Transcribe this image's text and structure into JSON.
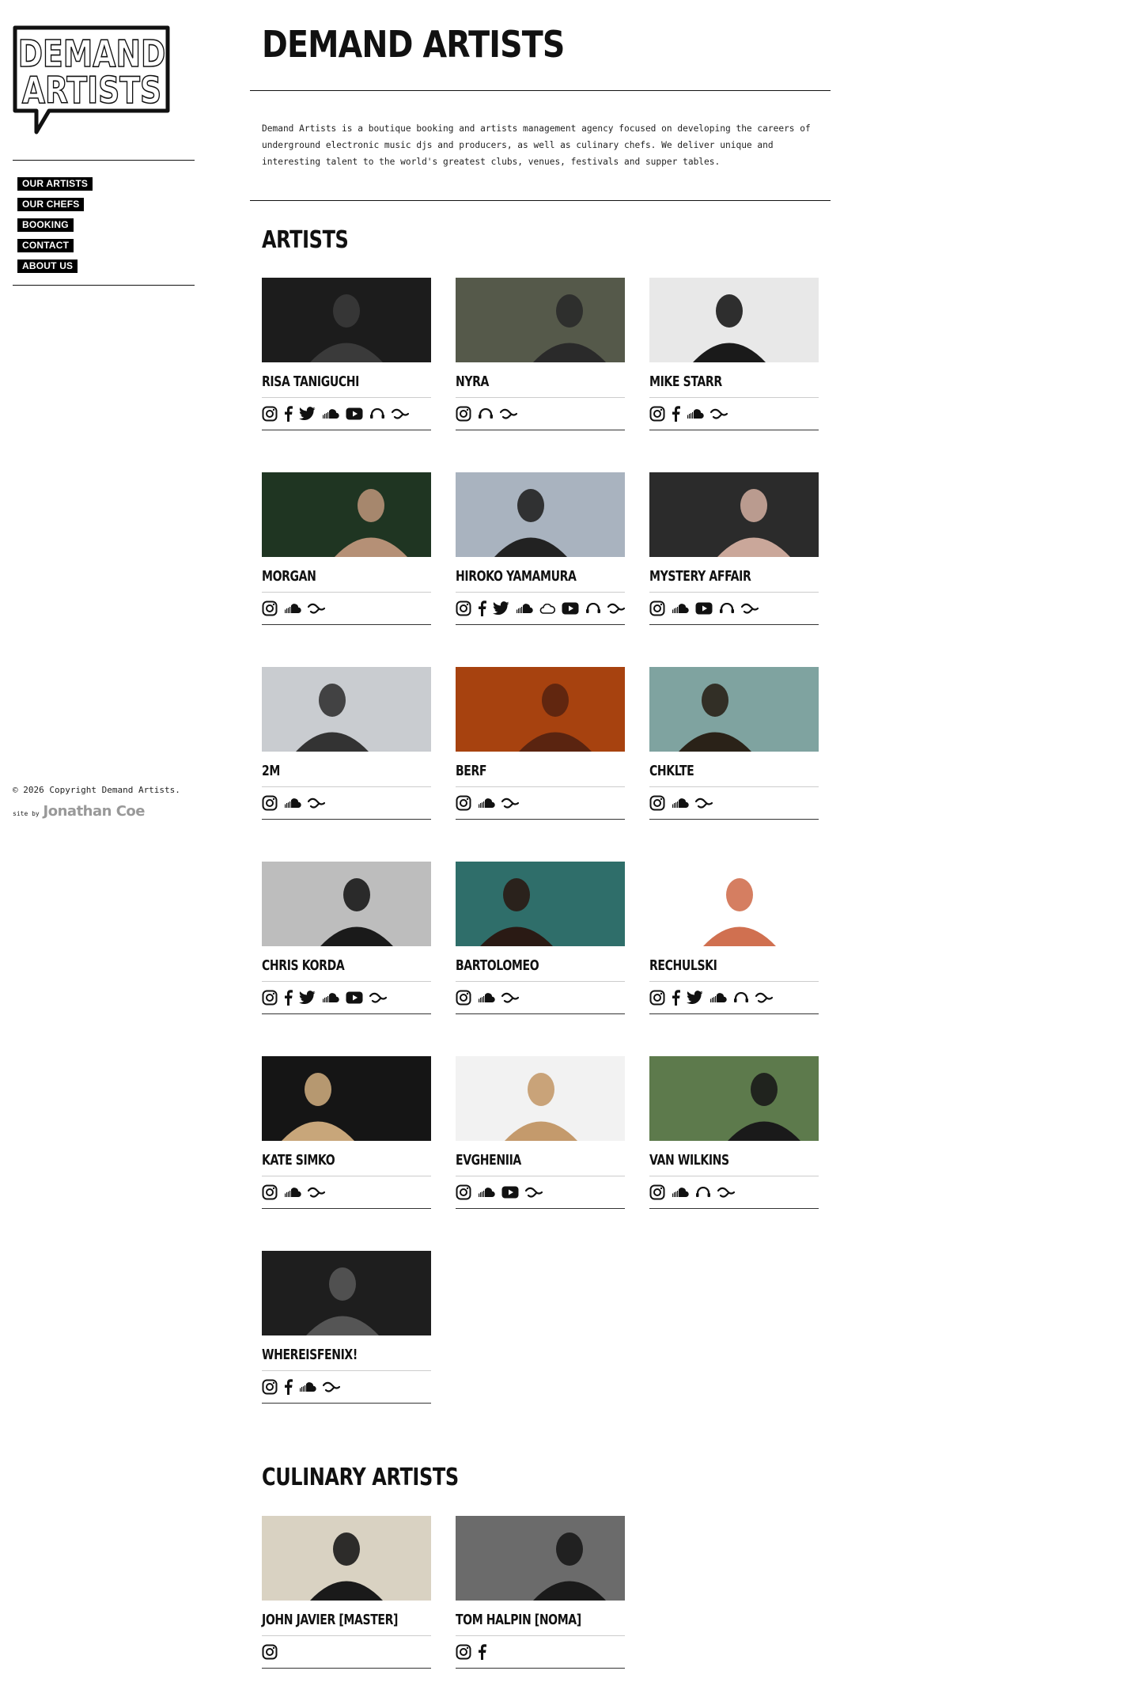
{
  "site": {
    "logo_line1": "DEMAND",
    "logo_line2": "ARTISTS",
    "title": "DEMAND ARTISTS",
    "intro": "Demand Artists is a boutique booking and artists management agency focused on developing the careers of underground electronic music djs and producers, as well as culinary chefs.  We deliver unique and interesting talent to the world's greatest clubs, venues, festivals and supper tables."
  },
  "nav": [
    {
      "label": "OUR ARTISTS"
    },
    {
      "label": "OUR CHEFS"
    },
    {
      "label": "BOOKING"
    },
    {
      "label": "CONTACT"
    },
    {
      "label": "ABOUT US"
    }
  ],
  "footer": {
    "copyright": "© 2026 Copyright Demand Artists.",
    "credit_prefix": "site by",
    "credit_name": "Jonathan Coe"
  },
  "colors": {
    "accent": "#000000",
    "text": "#111111",
    "credit": "#999999"
  },
  "artists_section": {
    "title": "ARTISTS",
    "items": [
      {
        "name": "RISA TANIGUCHI",
        "icons": [
          "instagram-icon",
          "facebook-icon",
          "twitter-icon",
          "soundcloud-icon",
          "youtube-icon",
          "mixcloud-icon",
          "residentadvisor-icon"
        ],
        "bg": "#1c1c1c",
        "fg": "#3a3a3a"
      },
      {
        "name": "NYRA",
        "icons": [
          "instagram-icon",
          "mixcloud-icon",
          "residentadvisor-icon"
        ],
        "bg": "#55594a",
        "fg": "#2a2a2a"
      },
      {
        "name": "MIKE STARR",
        "icons": [
          "instagram-icon",
          "facebook-icon",
          "soundcloud-icon",
          "residentadvisor-icon"
        ],
        "bg": "#e8e8e8",
        "fg": "#1a1a1a"
      },
      {
        "name": "MORGAN",
        "icons": [
          "instagram-icon",
          "soundcloud-icon",
          "residentadvisor-icon"
        ],
        "bg": "#1f3522",
        "fg": "#b59076"
      },
      {
        "name": "HIROKO YAMAMURA",
        "icons": [
          "instagram-icon",
          "facebook-icon",
          "twitter-icon",
          "soundcloud-icon",
          "cloud-outline-icon",
          "youtube-icon",
          "mixcloud-icon",
          "residentadvisor-icon"
        ],
        "bg": "#a9b3bf",
        "fg": "#222222"
      },
      {
        "name": "MYSTERY AFFAIR",
        "icons": [
          "instagram-icon",
          "soundcloud-icon",
          "youtube-icon",
          "mixcloud-icon",
          "residentadvisor-icon"
        ],
        "bg": "#2b2b2b",
        "fg": "#caa79a"
      },
      {
        "name": "2M",
        "icons": [
          "instagram-icon",
          "soundcloud-icon",
          "residentadvisor-icon"
        ],
        "bg": "#c9ccd0",
        "fg": "#333333"
      },
      {
        "name": "BERF",
        "icons": [
          "instagram-icon",
          "soundcloud-icon",
          "residentadvisor-icon"
        ],
        "bg": "#a7420f",
        "fg": "#5a2410"
      },
      {
        "name": "CHKLTE",
        "icons": [
          "instagram-icon",
          "soundcloud-icon",
          "residentadvisor-icon"
        ],
        "bg": "#7fa3a0",
        "fg": "#2a2218"
      },
      {
        "name": "CHRIS KORDA",
        "icons": [
          "instagram-icon",
          "facebook-icon",
          "twitter-icon",
          "soundcloud-icon",
          "youtube-icon",
          "residentadvisor-icon"
        ],
        "bg": "#bdbdbd",
        "fg": "#1a1a1a"
      },
      {
        "name": "BARTOLOMEO",
        "icons": [
          "instagram-icon",
          "soundcloud-icon",
          "residentadvisor-icon"
        ],
        "bg": "#2f6e6a",
        "fg": "#2a1a14"
      },
      {
        "name": "RECHULSKI",
        "icons": [
          "instagram-icon",
          "facebook-icon",
          "twitter-icon",
          "soundcloud-icon",
          "mixcloud-icon",
          "residentadvisor-icon"
        ],
        "bg": "#ffffff",
        "fg": "#d07050"
      },
      {
        "name": "KATE SIMKO",
        "icons": [
          "instagram-icon",
          "soundcloud-icon",
          "residentadvisor-icon"
        ],
        "bg": "#151515",
        "fg": "#c8a67a"
      },
      {
        "name": "EVGHENIIA",
        "icons": [
          "instagram-icon",
          "soundcloud-icon",
          "youtube-icon",
          "residentadvisor-icon"
        ],
        "bg": "#f2f2f2",
        "fg": "#c49a6c"
      },
      {
        "name": "VAN WILKINS",
        "icons": [
          "instagram-icon",
          "soundcloud-icon",
          "mixcloud-icon",
          "residentadvisor-icon"
        ],
        "bg": "#5d7a4c",
        "fg": "#1a1a1a"
      },
      {
        "name": "WHEREISFENIX!",
        "icons": [
          "instagram-icon",
          "facebook-icon",
          "soundcloud-icon",
          "residentadvisor-icon"
        ],
        "bg": "#1e1e1e",
        "fg": "#555555"
      }
    ]
  },
  "culinary_section": {
    "title": "CULINARY ARTISTS",
    "items": [
      {
        "name": "JOHN JAVIER [MASTER]",
        "icons": [
          "instagram-icon"
        ],
        "bg": "#d9d2c2",
        "fg": "#1a1a1a"
      },
      {
        "name": "TOM HALPIN [NOMA]",
        "icons": [
          "instagram-icon",
          "facebook-icon"
        ],
        "bg": "#6b6b6b",
        "fg": "#1a1a1a"
      }
    ]
  }
}
